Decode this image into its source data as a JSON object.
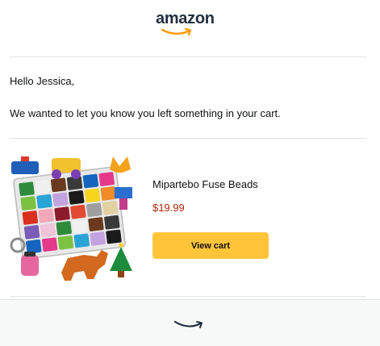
{
  "header": {
    "logo_text": "amazon"
  },
  "email": {
    "greeting": "Hello Jessica,",
    "message": "We wanted to let you know you left something in your cart."
  },
  "product": {
    "name": "Mipartebo Fuse Beads",
    "price": "$19.99",
    "image_icon": "fuse-beads-product-image"
  },
  "actions": {
    "view_cart_label": "View cart"
  },
  "colors": {
    "button": "#ffc43a",
    "price": "#b12704",
    "smile": "#ff9900",
    "logo": "#232f3e"
  }
}
